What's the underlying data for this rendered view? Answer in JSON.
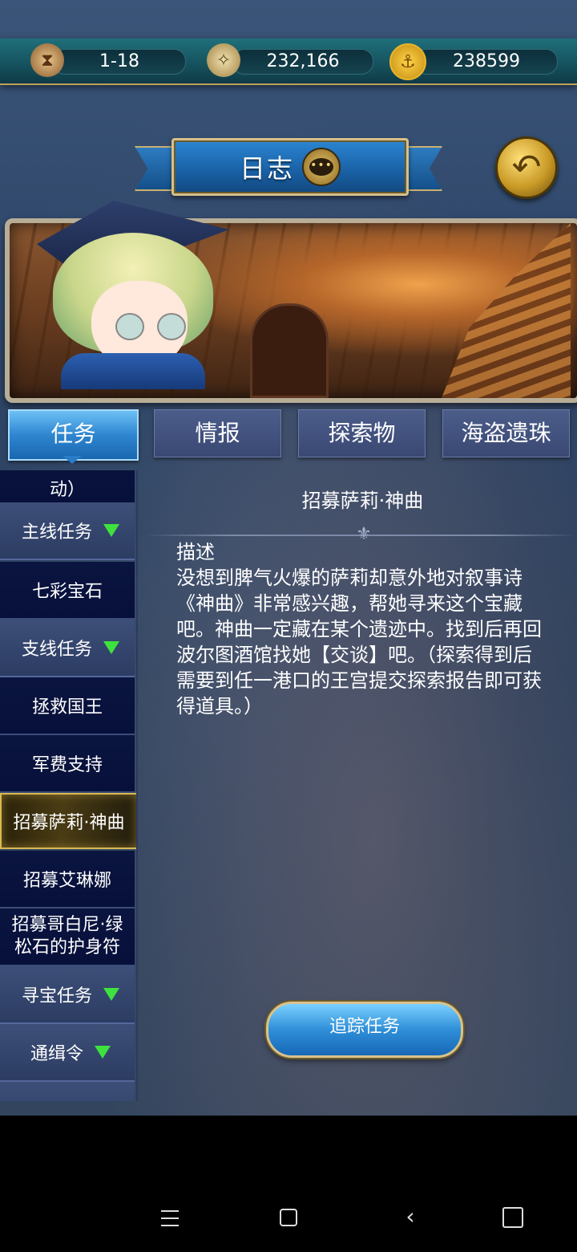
{
  "resources": {
    "level": "1-18",
    "silver": "232,166",
    "gold": "238599",
    "icons": [
      "hourglass-icon",
      "compass-coin-icon",
      "anchor-coin-icon"
    ]
  },
  "header": {
    "title": "日志",
    "title_icon": "chat-bubble-icon",
    "back_icon": "back-arrow-icon"
  },
  "tabs": [
    {
      "label": "任务",
      "selected": true
    },
    {
      "label": "情报",
      "selected": false
    },
    {
      "label": "探索物",
      "selected": false
    },
    {
      "label": "海盗遗珠",
      "selected": false
    }
  ],
  "side_list": {
    "partial_top": "动）",
    "items": [
      {
        "label": "主线任务",
        "type": "category",
        "icon": "expand-triangle-icon"
      },
      {
        "label": "七彩宝石",
        "type": "item"
      },
      {
        "label": "支线任务",
        "type": "category",
        "icon": "expand-triangle-icon"
      },
      {
        "label": "拯救国王",
        "type": "item"
      },
      {
        "label": "军费支持",
        "type": "item"
      },
      {
        "label": "招募萨莉·神曲",
        "type": "item",
        "selected": true
      },
      {
        "label": "招募艾琳娜",
        "type": "item"
      },
      {
        "label": "招募哥白尼·绿松石的护身符",
        "type": "item"
      },
      {
        "label": "寻宝任务",
        "type": "category",
        "icon": "expand-triangle-icon"
      },
      {
        "label": "通缉令",
        "type": "category",
        "icon": "expand-triangle-icon"
      }
    ]
  },
  "detail": {
    "title": "招募萨莉·神曲",
    "desc_heading": "描述",
    "desc_body": "没想到脾气火爆的萨莉却意外地对叙事诗《神曲》非常感兴趣，帮她寻来这个宝藏吧。神曲一定藏在某个遗迹中。找到后再回波尔图酒馆找她【交谈】吧。（探索得到后需要到任一港口的王宫提交探索报告即可获得道具。）",
    "track_button": "追踪任务"
  },
  "colors": {
    "accent_blue": "#2f86d0",
    "gold": "#d7b94f",
    "list_bg": "#0a1540",
    "expand_green": "#3ee23e"
  }
}
